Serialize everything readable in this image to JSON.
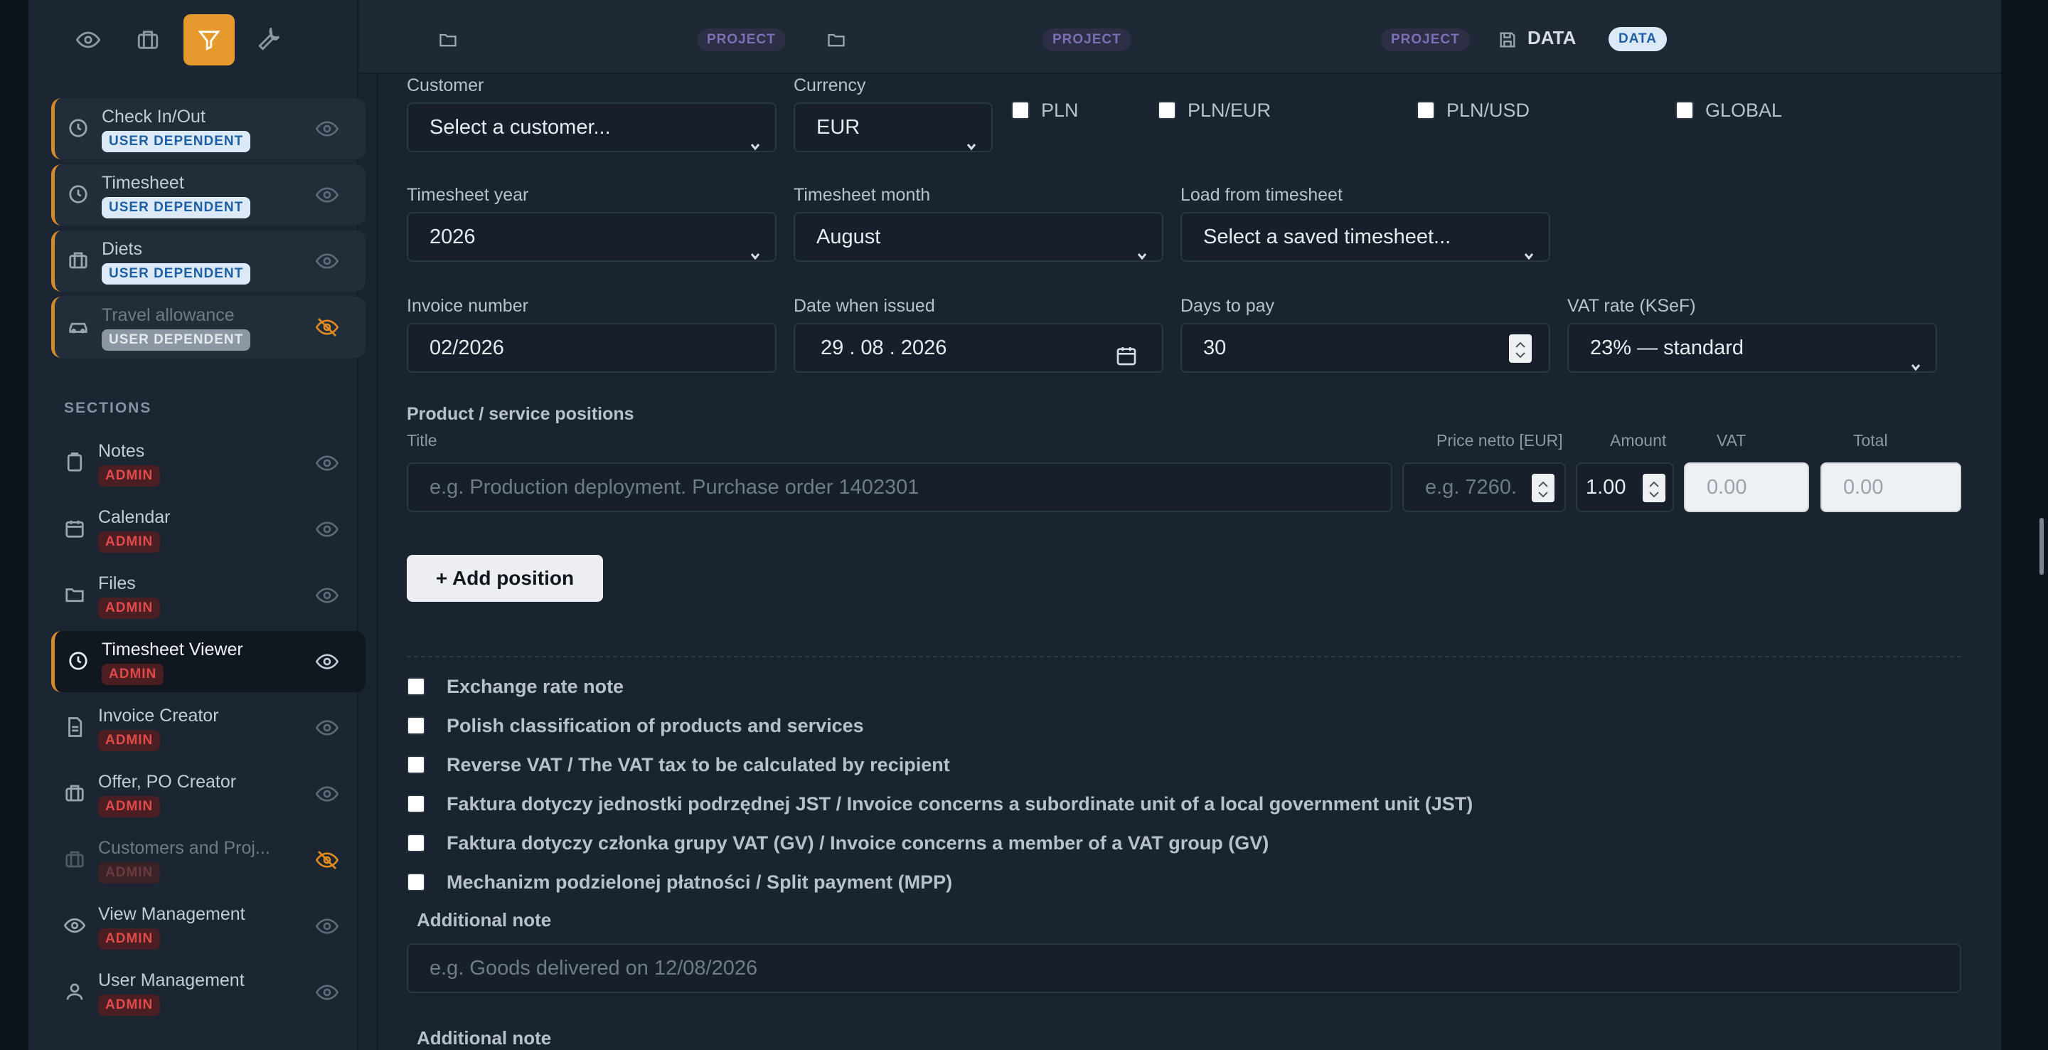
{
  "toolbar_icons": [
    "eye-icon",
    "briefcase-icon",
    "filter-icon",
    "wrench-icon"
  ],
  "sidebar": {
    "top_items": [
      {
        "label": "Check In/Out",
        "badge": "USER DEPENDENT",
        "icon": "clock-icon",
        "visible": true
      },
      {
        "label": "Timesheet",
        "badge": "USER DEPENDENT",
        "icon": "clock-icon",
        "visible": true
      },
      {
        "label": "Diets",
        "badge": "USER DEPENDENT",
        "icon": "briefcase-icon",
        "visible": true
      },
      {
        "label": "Travel allowance",
        "badge": "USER DEPENDENT",
        "icon": "car-icon",
        "visible": false
      }
    ],
    "sections_label": "SECTIONS",
    "section_items": [
      {
        "label": "Notes",
        "badge": "ADMIN",
        "icon": "clipboard-icon"
      },
      {
        "label": "Calendar",
        "badge": "ADMIN",
        "icon": "calendar-icon"
      },
      {
        "label": "Files",
        "badge": "ADMIN",
        "icon": "folder-icon"
      },
      {
        "label": "Timesheet Viewer",
        "badge": "ADMIN",
        "icon": "clock-icon"
      },
      {
        "label": "Invoice Creator",
        "badge": "ADMIN",
        "icon": "document-icon"
      },
      {
        "label": "Offer, PO Creator",
        "badge": "ADMIN",
        "icon": "briefcase-icon"
      },
      {
        "label": "Customers and Proj...",
        "badge": "ADMIN",
        "icon": "briefcase-icon"
      },
      {
        "label": "View Management",
        "badge": "ADMIN",
        "icon": "eye-icon"
      },
      {
        "label": "User Management",
        "badge": "ADMIN",
        "icon": "user-icon"
      }
    ]
  },
  "topbar": {
    "project_badge_1": "PROJECT",
    "project_badge_2": "PROJECT",
    "project_badge_3": "PROJECT",
    "data_label": "DATA",
    "data_badge": "DATA"
  },
  "form": {
    "customer_label": "Customer",
    "customer_value": "Select a customer...",
    "currency_label": "Currency",
    "currency_value": "EUR",
    "currency_checkboxes": [
      "PLN",
      "PLN/EUR",
      "PLN/USD",
      "GLOBAL"
    ],
    "year_label": "Timesheet year",
    "year_value": "2026",
    "month_label": "Timesheet month",
    "month_value": "August",
    "load_label": "Load from timesheet",
    "load_value": "Select a saved timesheet...",
    "invoice_number_label": "Invoice number",
    "invoice_number_value": "02/2026",
    "date_label": "Date when issued",
    "date_value": "29 . 08 . 2026",
    "days_label": "Days to pay",
    "days_value": "30",
    "vat_rate_label": "VAT rate (KSeF)",
    "vat_rate_value": "23% — standard",
    "positions_label": "Product / service positions",
    "title_col": "Title",
    "price_col": "Price netto [EUR]",
    "amount_col": "Amount",
    "vat_col": "VAT",
    "total_col": "Total",
    "title_placeholder": "e.g. Production deployment. Purchase order 1402301",
    "price_placeholder": "e.g. 7260.",
    "amount_value": "1.00",
    "vat_value": "0.00",
    "total_value": "0.00",
    "add_position_label": "+ Add position",
    "options": [
      "Exchange rate note",
      "Polish classification of products and services",
      "Reverse VAT / The VAT tax to be calculated by recipient",
      "Faktura dotyczy jednostki podrzędnej JST / Invoice concerns a subordinate unit of a local government unit (JST)",
      "Faktura dotyczy członka grupy VAT (GV) / Invoice concerns a member of a VAT group (GV)",
      "Mechanizm podzielonej płatności / Split payment (MPP)"
    ],
    "additional_note_label": "Additional note",
    "additional_note_placeholder": "e.g. Goods delivered on 12/08/2026",
    "additional_note_label_2": "Additional note"
  },
  "colors": {
    "accent": "#e69a2e",
    "admin_badge": "#e04a4a",
    "user_badge_bg": "#dce9f7"
  }
}
